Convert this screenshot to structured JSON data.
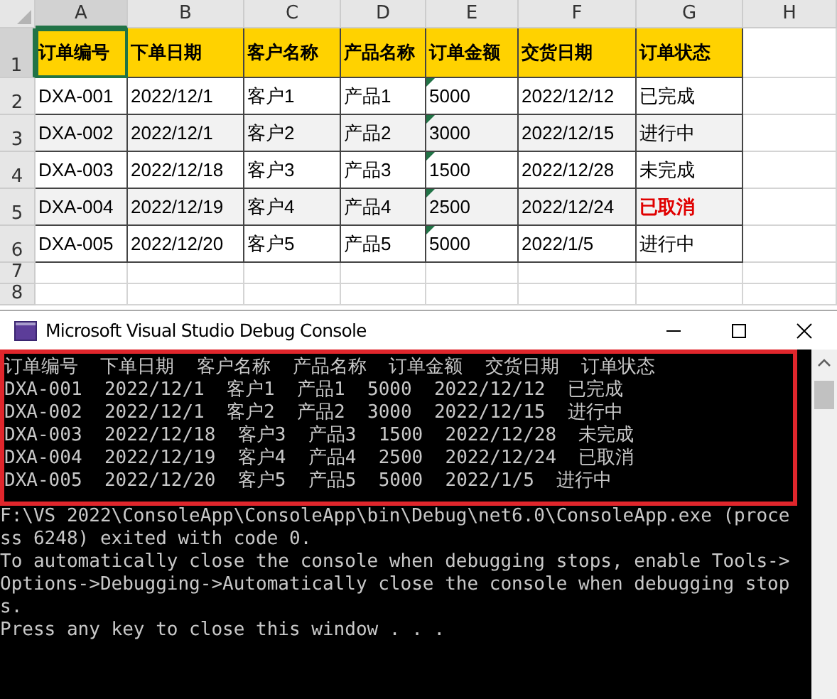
{
  "sheet": {
    "columns": [
      {
        "label": "A",
        "selected": true
      },
      {
        "label": "B",
        "selected": false
      },
      {
        "label": "C",
        "selected": false
      },
      {
        "label": "D",
        "selected": false
      },
      {
        "label": "E",
        "selected": false
      },
      {
        "label": "F",
        "selected": false
      },
      {
        "label": "G",
        "selected": false
      },
      {
        "label": "H",
        "selected": false
      }
    ],
    "row_numbers": [
      {
        "label": "1",
        "selected": true
      },
      {
        "label": "2",
        "selected": false
      },
      {
        "label": "3",
        "selected": false
      },
      {
        "label": "4",
        "selected": false
      },
      {
        "label": "5",
        "selected": false
      },
      {
        "label": "6",
        "selected": false
      },
      {
        "label": "7",
        "selected": false
      },
      {
        "label": "8",
        "selected": false
      }
    ],
    "header": [
      "订单编号",
      "下单日期",
      "客户名称",
      "产品名称",
      "订单金额",
      "交货日期",
      "订单状态"
    ],
    "rows": [
      {
        "cells": [
          "DXA-001",
          "2022/12/1",
          "客户1",
          "产品1",
          "5000",
          "2022/12/12",
          "已完成"
        ],
        "shaded": false,
        "amount_flagged": true,
        "status_alert": false
      },
      {
        "cells": [
          "DXA-002",
          "2022/12/1",
          "客户2",
          "产品2",
          "3000",
          "2022/12/15",
          "进行中"
        ],
        "shaded": true,
        "amount_flagged": true,
        "status_alert": false
      },
      {
        "cells": [
          "DXA-003",
          "2022/12/18",
          "客户3",
          "产品3",
          "1500",
          "2022/12/28",
          "未完成"
        ],
        "shaded": false,
        "amount_flagged": true,
        "status_alert": false
      },
      {
        "cells": [
          "DXA-004",
          "2022/12/19",
          "客户4",
          "产品4",
          "2500",
          "2022/12/24",
          "已取消"
        ],
        "shaded": true,
        "amount_flagged": true,
        "status_alert": true
      },
      {
        "cells": [
          "DXA-005",
          "2022/12/20",
          "客户5",
          "产品5",
          "5000",
          "2022/1/5",
          "进行中"
        ],
        "shaded": false,
        "amount_flagged": true,
        "status_alert": false
      }
    ]
  },
  "console": {
    "title": "Microsoft Visual Studio Debug Console",
    "blocks": [
      {
        "highlighted": true,
        "lines": [
          "订单编号  下单日期  客户名称  产品名称  订单金额  交货日期  订单状态",
          "DXA-001  2022/12/1  客户1  产品1  5000  2022/12/12  已完成",
          "DXA-002  2022/12/1  客户2  产品2  3000  2022/12/15  进行中",
          "DXA-003  2022/12/18  客户3  产品3  1500  2022/12/28  未完成",
          "DXA-004  2022/12/19  客户4  产品4  2500  2022/12/24  已取消",
          "DXA-005  2022/12/20  客户5  产品5  5000  2022/1/5  进行中"
        ]
      },
      {
        "highlighted": false,
        "lines": [
          "F:\\VS 2022\\ConsoleApp\\ConsoleApp\\bin\\Debug\\net6.0\\ConsoleApp.exe (proce",
          "ss 6248) exited with code 0.",
          "To automatically close the console when debugging stops, enable Tools->",
          "Options->Debugging->Automatically close the console when debugging stop",
          "s.",
          "Press any key to close this window . . ."
        ]
      }
    ]
  }
}
